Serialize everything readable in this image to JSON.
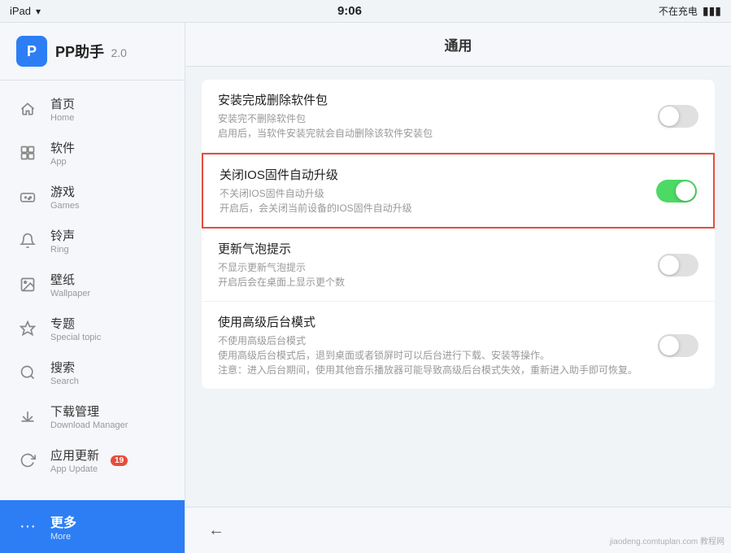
{
  "statusBar": {
    "left": "iPad",
    "time": "9:06",
    "right": "不在充电",
    "wifi": "▲",
    "battery": "🔋"
  },
  "sidebar": {
    "appName": "PP助手",
    "appVersion": "2.0",
    "logoText": "P",
    "items": [
      {
        "id": "home",
        "cn": "首页",
        "en": "Home",
        "icon": "⌂",
        "active": false
      },
      {
        "id": "app",
        "cn": "软件",
        "en": "App",
        "icon": "□",
        "active": false
      },
      {
        "id": "games",
        "cn": "游戏",
        "en": "Games",
        "icon": "◉",
        "active": false
      },
      {
        "id": "ring",
        "cn": "铃声",
        "en": "Ring",
        "icon": "🔔",
        "active": false
      },
      {
        "id": "wallpaper",
        "cn": "壁纸",
        "en": "Wallpaper",
        "icon": "▦",
        "active": false
      },
      {
        "id": "special",
        "cn": "专题",
        "en": "Special topic",
        "icon": "☆",
        "active": false
      },
      {
        "id": "search",
        "cn": "搜索",
        "en": "Search",
        "icon": "○",
        "active": false
      },
      {
        "id": "download",
        "cn": "下载管理",
        "en": "Download Manager",
        "icon": "↓",
        "active": false
      },
      {
        "id": "update",
        "cn": "应用更新",
        "en": "App Update",
        "icon": "↻",
        "active": false,
        "badge": "19"
      }
    ],
    "more": {
      "cn": "更多",
      "en": "More",
      "icon": "···",
      "active": true
    }
  },
  "content": {
    "title": "通用",
    "settings": [
      {
        "id": "delete-after-install",
        "title": "安装完成删除软件包",
        "desc1": "安装完不删除软件包",
        "desc2": "启用后，当软件安装完就会自动删除该软件安装包",
        "toggle": "off",
        "highlighted": false
      },
      {
        "id": "disable-ios-update",
        "title": "关闭IOS固件自动升级",
        "desc1": "不关闭IOS固件自动升级",
        "desc2": "开启后，会关闭当前设备的IOS固件自动升级",
        "toggle": "on",
        "highlighted": true
      },
      {
        "id": "update-bubble",
        "title": "更新气泡提示",
        "desc1": "不显示更新气泡提示",
        "desc2": "开启后会在桌面上显示更个数",
        "toggle": "off",
        "highlighted": false
      },
      {
        "id": "advanced-background",
        "title": "使用高级后台模式",
        "desc1": "不使用高级后台模式",
        "desc2": "使用高级后台模式后，退到桌面或者锁屏时可以后台进行下载、安装等操作。\n注意：进入后台期间，使用其他音乐播放器可能导致高级后台模式失效，重新进入助手即可恢复。",
        "toggle": "off",
        "highlighted": false
      }
    ]
  },
  "watermark": "jiaodeng.comtuplan.com 教程网"
}
